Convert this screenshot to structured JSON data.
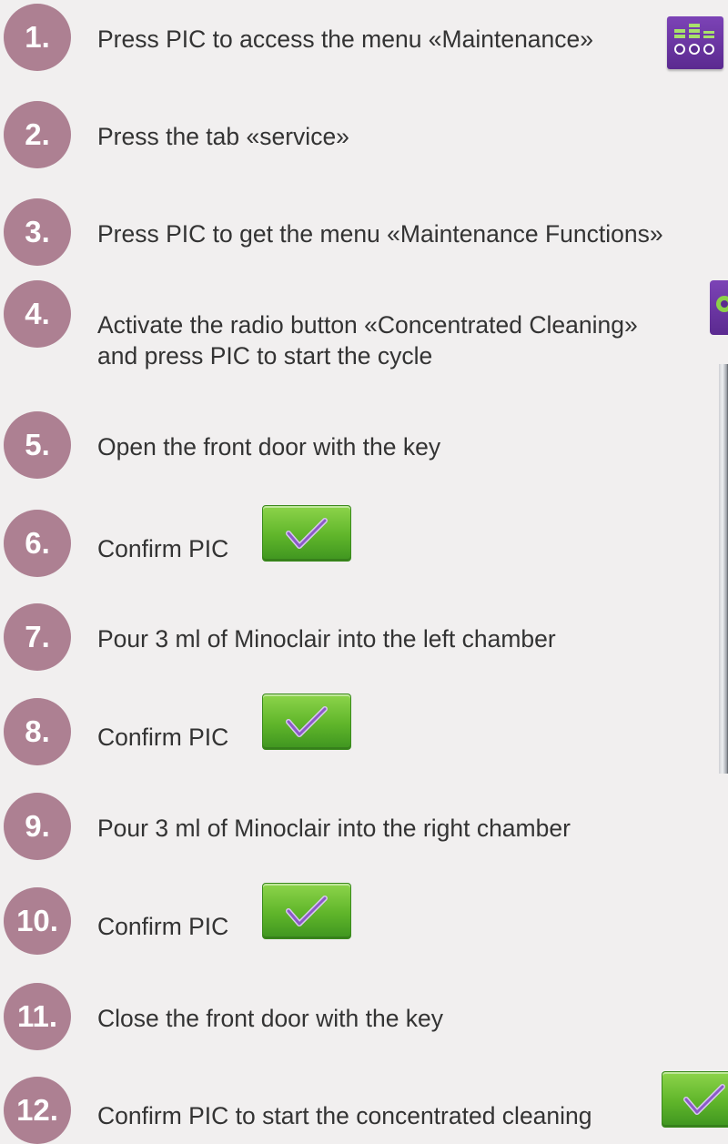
{
  "steps": [
    {
      "number": "1.",
      "text": "Press PIC to access the menu «Maintenance»",
      "icon": "maintenance-menu-icon"
    },
    {
      "number": "2.",
      "text": "Press the tab «service»"
    },
    {
      "number": "3.",
      "text": "Press PIC to get the menu «Maintenance Functions»"
    },
    {
      "number": "4.",
      "text_line1": "Activate the radio button «Concentrated Cleaning»",
      "text_line2": "and press PIC to start the cycle",
      "icon": "gear-icon"
    },
    {
      "number": "5.",
      "text": "Open the front door with the key"
    },
    {
      "number": "6.",
      "text": "Confirm PIC",
      "icon": "checkmark-icon"
    },
    {
      "number": "7.",
      "text": "Pour 3 ml of Minoclair into the left chamber"
    },
    {
      "number": "8.",
      "text": "Confirm PIC",
      "icon": "checkmark-icon"
    },
    {
      "number": "9.",
      "text": "Pour 3 ml of Minoclair into the right chamber"
    },
    {
      "number": "10.",
      "text": "Confirm PIC",
      "icon": "checkmark-icon"
    },
    {
      "number": "11.",
      "text": "Close the front door with the key"
    },
    {
      "number": "12.",
      "text": "Confirm PIC to start the concentrated cleaning",
      "icon": "checkmark-icon"
    }
  ],
  "colors": {
    "badge": "#ad8092",
    "background": "#f1efef",
    "text": "#333333",
    "confirm_button": "#5fb52a",
    "maintenance_icon": "#6a35a3"
  }
}
